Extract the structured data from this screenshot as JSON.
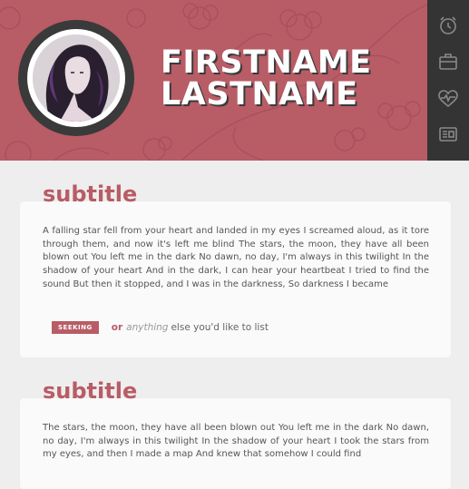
{
  "profile": {
    "first_name": "FIRSTNAME",
    "last_name": "LASTNAME"
  },
  "sidebar": {
    "items": [
      {
        "icon": "alarm-clock-icon"
      },
      {
        "icon": "briefcase-icon"
      },
      {
        "icon": "heartbeat-icon"
      },
      {
        "icon": "id-card-icon"
      }
    ]
  },
  "sections": [
    {
      "title": "subtitle",
      "body": "A falling star fell from your heart and landed in my eyes I screamed aloud, as it tore through them, and now it's left me blind The stars, the moon, they have all been blown out You left me in the dark No dawn, no day, I'm always in this twilight In the shadow of your heart And in the dark, I can hear your heartbeat I tried to find the sound But then it stopped, and I was in the darkness, So darkness I became",
      "tag": {
        "badge": "SEEKING",
        "or": "or",
        "emphasis": "anything",
        "rest": "else you'd like to list"
      }
    },
    {
      "title": "subtitle",
      "body": "The stars, the moon, they have all been blown out You left me in the dark No dawn, no day, I'm always in this twilight In the shadow of your heart I took the stars from my eyes, and then I made a map And knew that somehow I could find"
    }
  ],
  "colors": {
    "accent": "#b85c66",
    "sidebar": "#343434",
    "background": "#eeeeee",
    "card": "#fafafa"
  }
}
